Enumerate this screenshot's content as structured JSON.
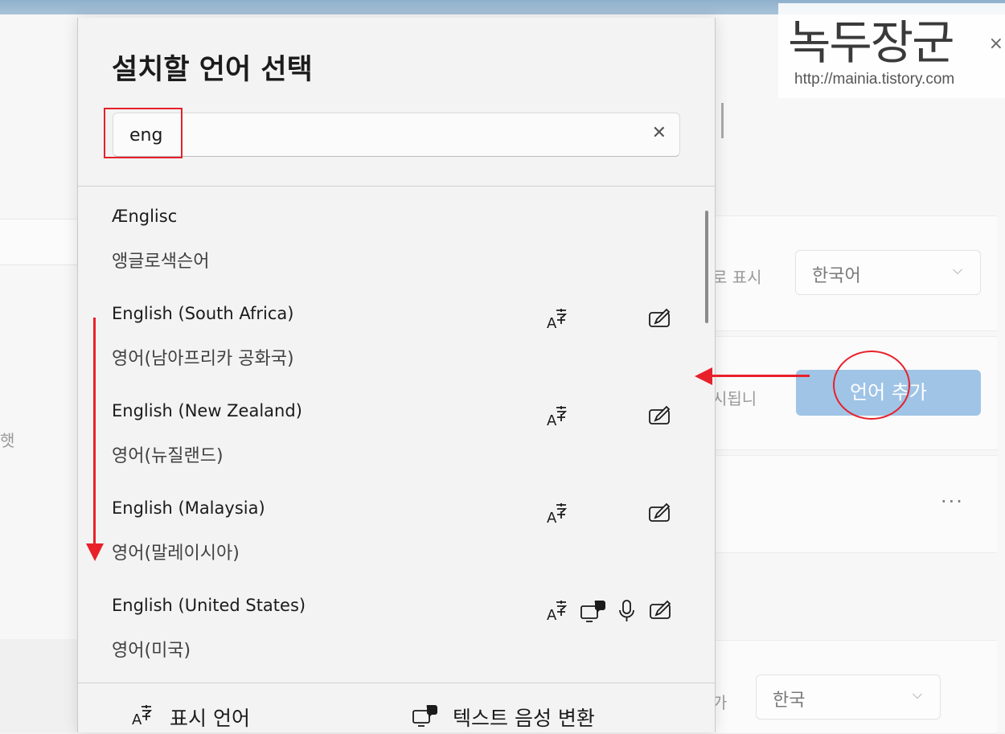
{
  "watermark": {
    "title": "녹두장군",
    "url": "http://mainia.tistory.com",
    "close": "×"
  },
  "background": {
    "left_fragment": "햇",
    "display_label": "로 표시",
    "display_select": "한국어",
    "display_hint": "시됩니",
    "add_language_button": "언어 추가",
    "more": "···",
    "region_label": "가",
    "region_select": "한국"
  },
  "dialog": {
    "title": "설치할 언어 선택",
    "search": {
      "value": "eng",
      "placeholder": ""
    },
    "languages": [
      {
        "name": "Ænglisc",
        "native": "앵글로색슨어",
        "features": []
      },
      {
        "name": "English (South Africa)",
        "native": "영어(남아프리카 공화국)",
        "features": [
          "display-language-icon",
          "handwriting-icon"
        ]
      },
      {
        "name": "English (New Zealand)",
        "native": "영어(뉴질랜드)",
        "features": [
          "display-language-icon",
          "handwriting-icon"
        ]
      },
      {
        "name": "English (Malaysia)",
        "native": "영어(말레이시아)",
        "features": [
          "display-language-icon",
          "handwriting-icon"
        ]
      },
      {
        "name": "English (United States)",
        "native": "영어(미국)",
        "features": [
          "display-language-icon",
          "text-to-speech-icon",
          "speech-recognition-icon",
          "handwriting-icon"
        ]
      }
    ],
    "legend": {
      "display_language": "표시 언어",
      "text_to_speech": "텍스트 음성 변환"
    }
  },
  "colors": {
    "annotation": "#e8202a",
    "accent_button": "#9fc4e6"
  }
}
